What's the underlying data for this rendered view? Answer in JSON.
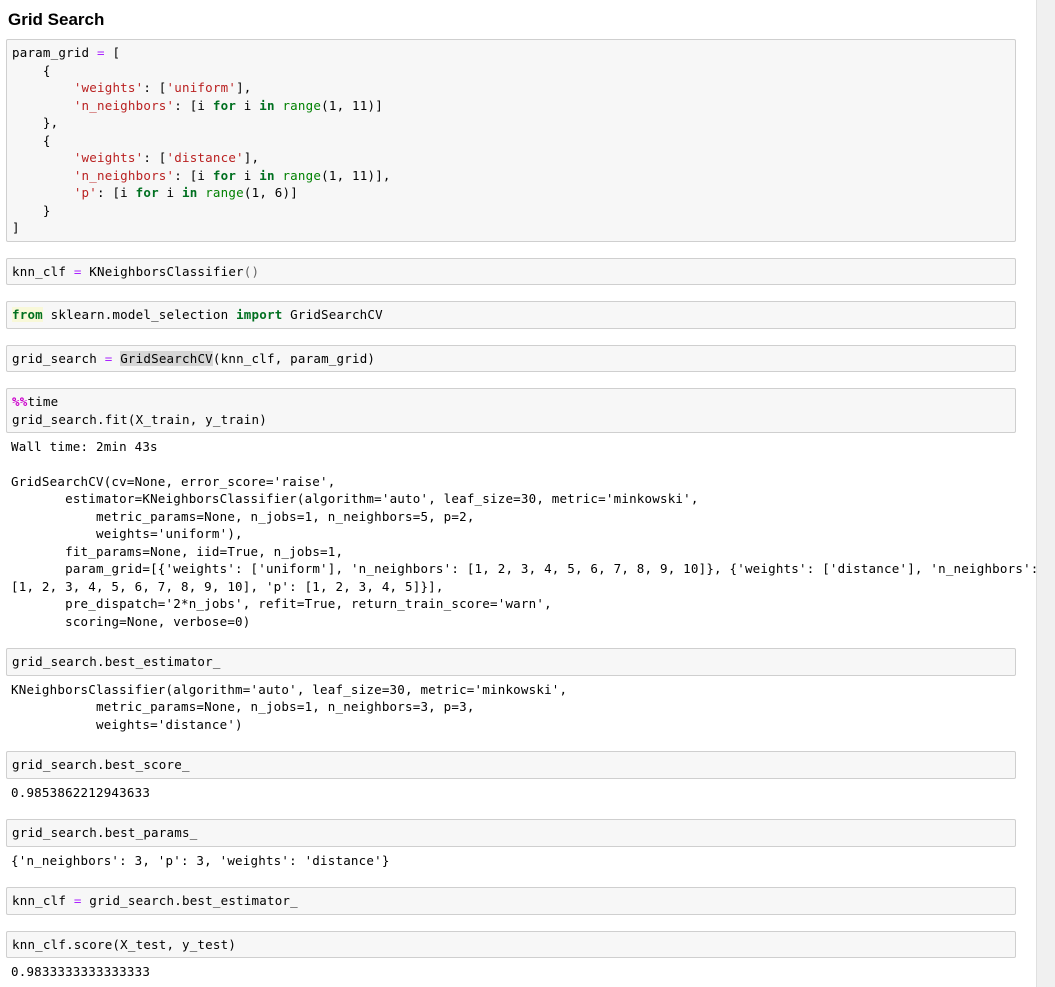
{
  "notebook": {
    "title": "Grid Search",
    "cells": [
      {
        "id": "cell-param-grid",
        "type": "code",
        "source_lines": [
          "param_grid = [",
          "    {",
          "        'weights': ['uniform'],",
          "        'n_neighbors': [i for i in range(1, 11)]",
          "    },",
          "    {",
          "        'weights': ['distance'],",
          "        'n_neighbors': [i for i in range(1, 11)],",
          "        'p': [i for i in range(1, 6)]",
          "    }",
          "]"
        ]
      },
      {
        "id": "cell-knn-clf",
        "type": "code",
        "source_lines": [
          "knn_clf = KNeighborsClassifier()"
        ]
      },
      {
        "id": "cell-import-gridsearchcv",
        "type": "code",
        "source_lines": [
          "from sklearn.model_selection import GridSearchCV"
        ]
      },
      {
        "id": "cell-grid-search-init",
        "type": "code",
        "source_lines": [
          "grid_search = GridSearchCV(knn_clf, param_grid)"
        ],
        "highlighted_token": "GridSearchCV"
      },
      {
        "id": "cell-fit",
        "type": "code",
        "source_lines": [
          "%%time",
          "grid_search.fit(X_train, y_train)"
        ],
        "output_id": "output-fit"
      },
      {
        "id": "cell-best-estimator",
        "type": "code",
        "source_lines": [
          "grid_search.best_estimator_"
        ],
        "output_id": "output-best-estimator"
      },
      {
        "id": "cell-best-score",
        "type": "code",
        "source_lines": [
          "grid_search.best_score_"
        ],
        "output_id": "output-best-score"
      },
      {
        "id": "cell-best-params",
        "type": "code",
        "source_lines": [
          "grid_search.best_params_"
        ],
        "output_id": "output-best-params"
      },
      {
        "id": "cell-assign-best",
        "type": "code",
        "source_lines": [
          "knn_clf = grid_search.best_estimator_"
        ]
      },
      {
        "id": "cell-score-test",
        "type": "code",
        "source_lines": [
          "knn_clf.score(X_test, y_test)"
        ],
        "output_id": "output-score-test"
      }
    ],
    "outputs": {
      "fit_walltime": "Wall time: 2min 43s",
      "fit_repr": "GridSearchCV(cv=None, error_score='raise',\n       estimator=KNeighborsClassifier(algorithm='auto', leaf_size=30, metric='minkowski',\n           metric_params=None, n_jobs=1, n_neighbors=5, p=2,\n           weights='uniform'),\n       fit_params=None, iid=True, n_jobs=1,\n       param_grid=[{'weights': ['uniform'], 'n_neighbors': [1, 2, 3, 4, 5, 6, 7, 8, 9, 10]}, {'weights': ['distance'], 'n_neighbors': [1, 2, 3, 4, 5, 6, 7, 8, 9, 10], 'p': [1, 2, 3, 4, 5]}],\n       pre_dispatch='2*n_jobs', refit=True, return_train_score='warn',\n       scoring=None, verbose=0)",
      "best_estimator_repr": "KNeighborsClassifier(algorithm='auto', leaf_size=30, metric='minkowski',\n           metric_params=None, n_jobs=1, n_neighbors=3, p=3,\n           weights='distance')",
      "best_score_value": "0.9853862212943633",
      "best_params_value": "{'n_neighbors': 3, 'p': 3, 'weights': 'distance'}",
      "test_score_value": "0.9833333333333333"
    }
  },
  "colors": {
    "keyword": "#007020",
    "string": "#ba2121",
    "operator": "#aa22ff",
    "builtin": "#008000",
    "magic": "#cc00cc",
    "cell_background": "#f7f7f7",
    "cell_border": "#cfcfcf",
    "page_background": "#ffffff",
    "scrollbar": "#f0f0f0"
  }
}
